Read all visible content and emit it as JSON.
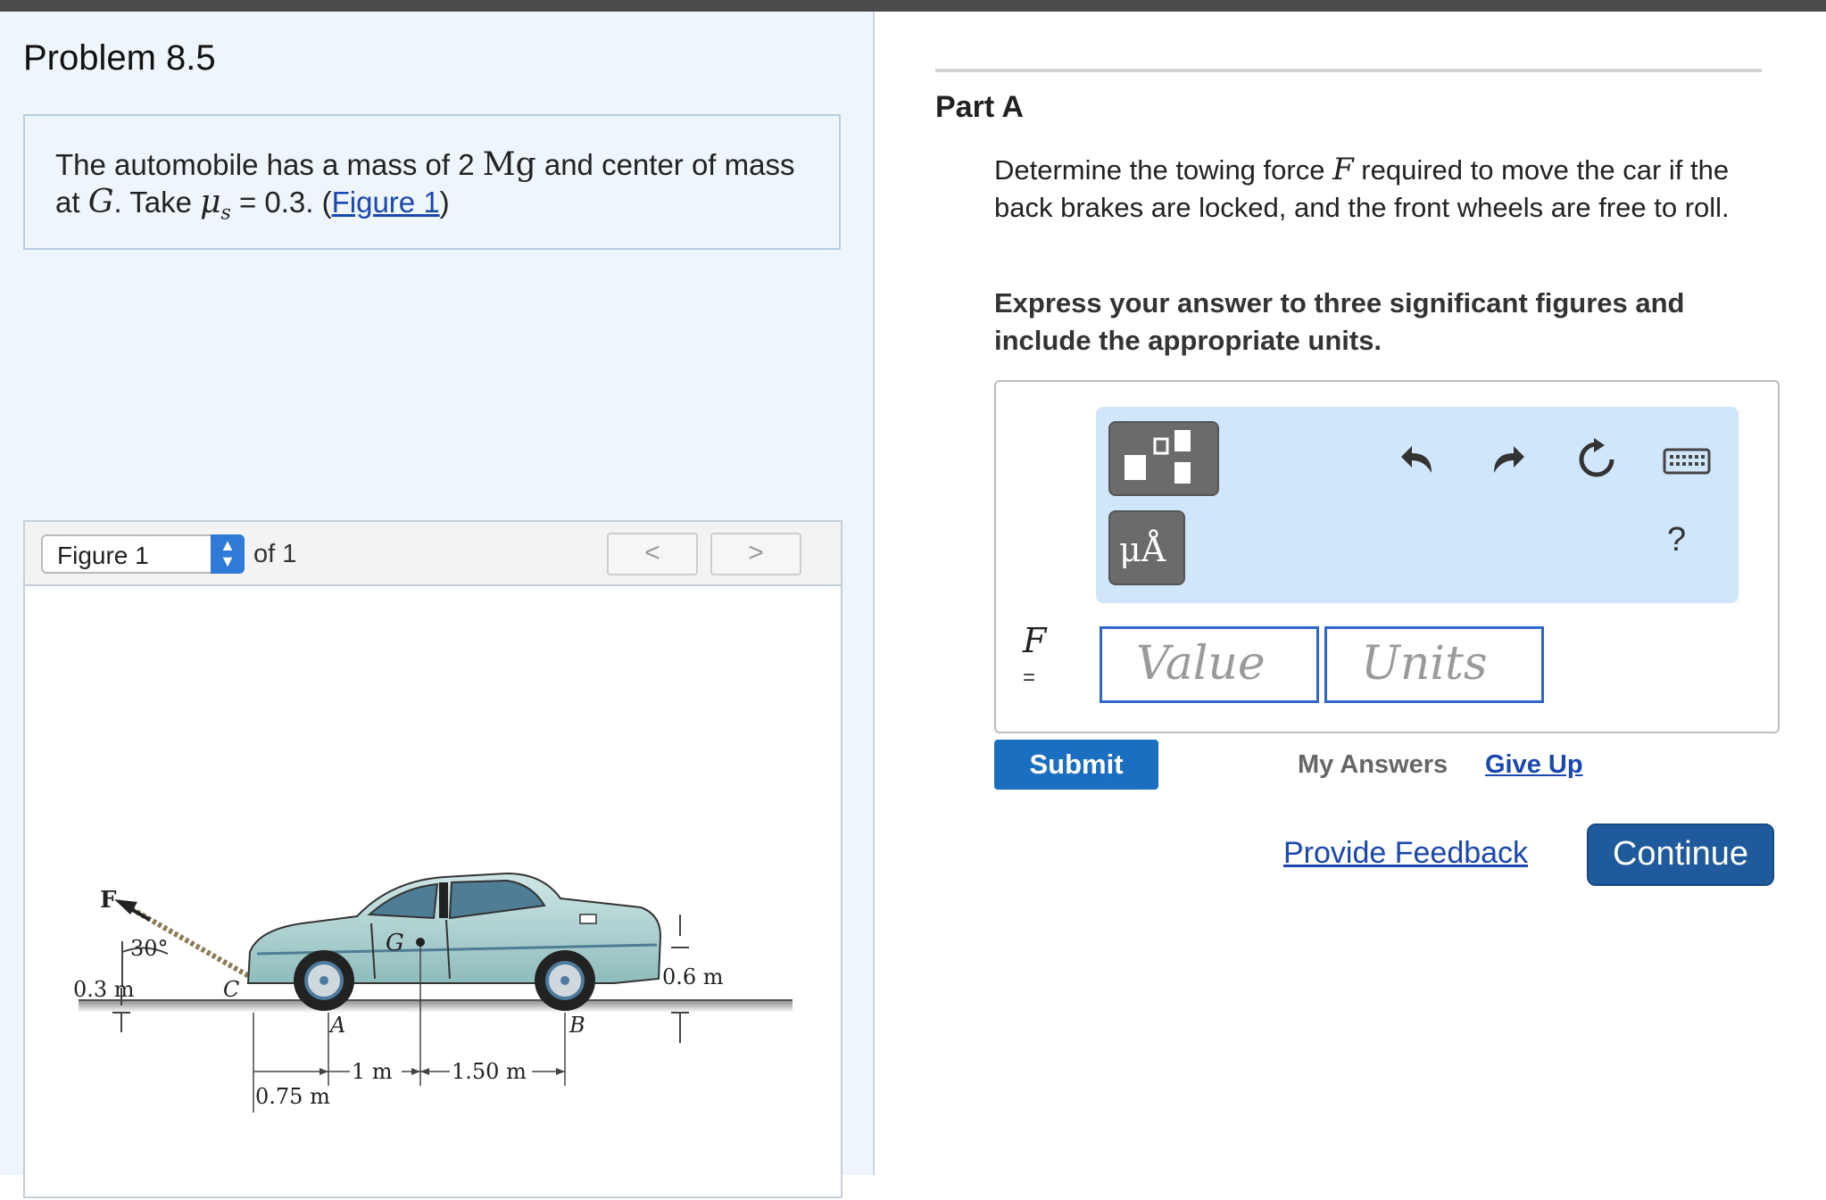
{
  "problem": {
    "title": "Problem 8.5",
    "statement": {
      "t1": "The automobile has a mass of 2 ",
      "unit": "Mg",
      "t2": " and center of mass at ",
      "g": "G",
      "t3": ". Take ",
      "mu": "μ",
      "sub": "s",
      "t4": " = 0.3. (",
      "link": "Figure 1",
      "t5": ")"
    }
  },
  "figure_nav": {
    "select_value": "Figure 1",
    "of_text": "of 1",
    "prev": "<",
    "next": ">"
  },
  "figure": {
    "force": "F",
    "angle": "30°",
    "height_hitch": "0.3 m",
    "point_c": "C",
    "point_g": "G",
    "point_a": "A",
    "point_b": "B",
    "height_g": "0.6 m",
    "dim_1": "1 m",
    "dim_2": "1.50 m",
    "dim_3": "0.75 m"
  },
  "part": {
    "title": "Part A",
    "question": {
      "q1": "Determine the towing force ",
      "var": "F",
      "q2": " required to move the car if the back brakes are locked, and the front wheels are free to roll."
    },
    "instructions": "Express your answer to three significant figures and include the appropriate units."
  },
  "answer": {
    "tool_units": "μÅ",
    "help": "?",
    "variable": "F",
    "equals": "=",
    "value_placeholder": "Value",
    "units_placeholder": "Units"
  },
  "actions": {
    "submit": "Submit",
    "my_answers": "My Answers",
    "give_up": "Give Up",
    "feedback": "Provide Feedback",
    "continue": "Continue"
  },
  "colors": {
    "panel_bg": "#eef5fb",
    "link": "#1a47b0",
    "submit_bg": "#1b6fc1",
    "continue_bg": "#1f5a9d",
    "toolbar_bg": "#cfe6fb",
    "input_border": "#2e67c9"
  }
}
